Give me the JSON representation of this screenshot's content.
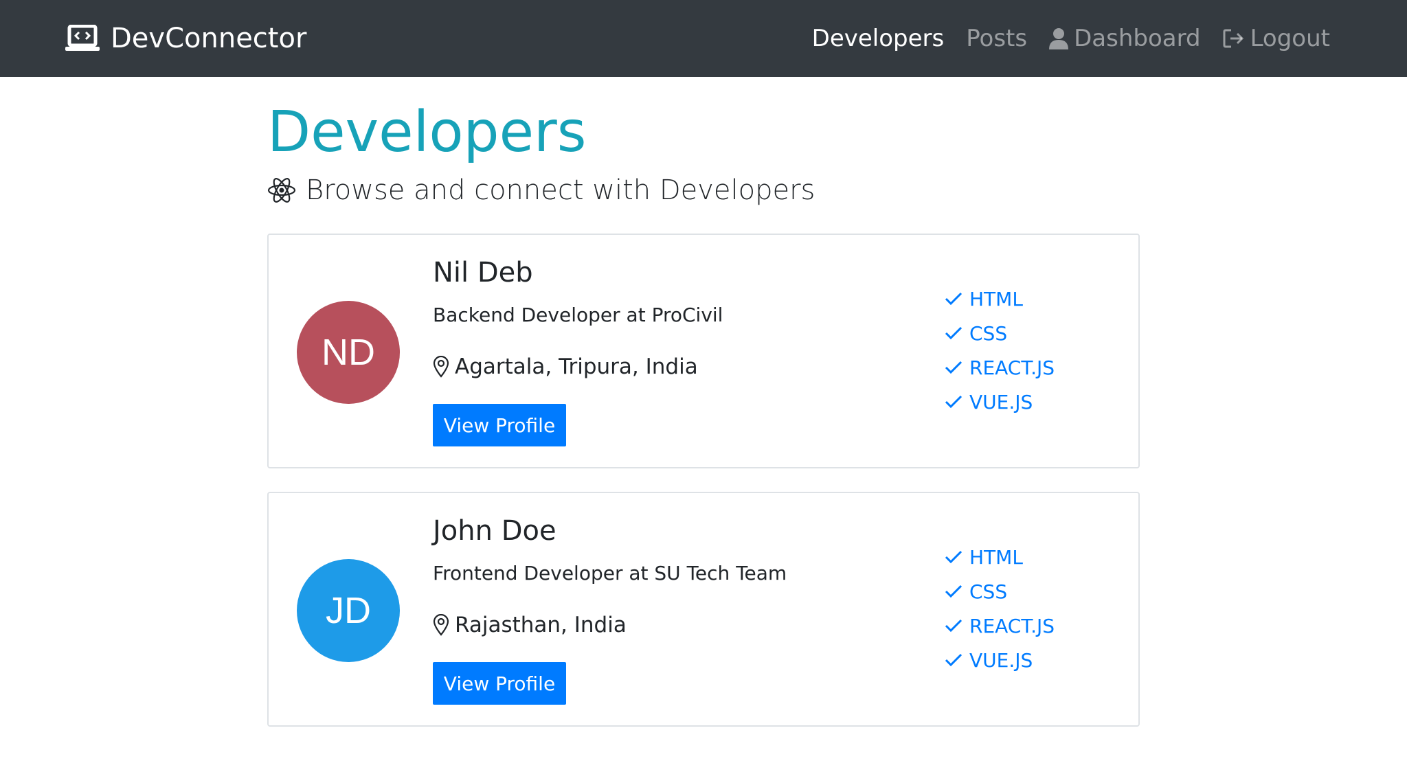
{
  "navbar": {
    "brand": "DevConnector",
    "links": [
      {
        "label": "Developers",
        "active": true
      },
      {
        "label": "Posts",
        "active": false
      },
      {
        "label": "Dashboard",
        "active": false
      },
      {
        "label": "Logout",
        "active": false
      }
    ]
  },
  "page": {
    "title": "Developers",
    "subtitle": "Browse and connect with Developers"
  },
  "profiles": [
    {
      "initials": "ND",
      "avatar_color": "#b7505c",
      "name": "Nil Deb",
      "status": "Backend Developer at ProCivil",
      "location": "Agartala, Tripura, India",
      "button": "View Profile",
      "skills": [
        "HTML",
        "CSS",
        "REACT.JS",
        "VUE.JS"
      ]
    },
    {
      "initials": "JD",
      "avatar_color": "#1e9be8",
      "name": "John Doe",
      "status": "Frontend Developer at SU Tech Team",
      "location": "Rajasthan, India",
      "button": "View Profile",
      "skills": [
        "HTML",
        "CSS",
        "REACT.JS",
        "VUE.JS"
      ]
    }
  ],
  "colors": {
    "navbar": "#343a40",
    "title": "#17a2b8",
    "primary": "#007bff"
  }
}
